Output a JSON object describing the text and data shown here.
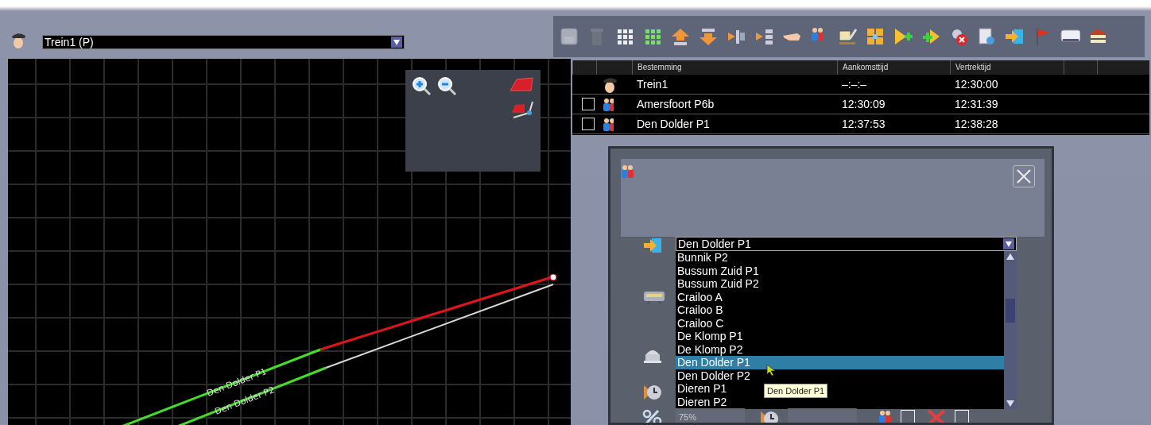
{
  "train_select": {
    "value": "Trein1 (P)"
  },
  "map": {
    "track_labels": [
      "Den Dolder P1",
      "Den Dolder P2"
    ]
  },
  "toolbar": [
    {
      "kind": "save",
      "disabled": true
    },
    {
      "kind": "trash",
      "disabled": true
    },
    {
      "kind": "small-grid",
      "disabled": false
    },
    {
      "kind": "grid",
      "disabled": false
    },
    {
      "kind": "move-up",
      "disabled": false
    },
    {
      "kind": "move-down",
      "disabled": false
    },
    {
      "kind": "insert-right",
      "disabled": false
    },
    {
      "kind": "insert-left",
      "disabled": false
    },
    {
      "kind": "hand",
      "disabled": false
    },
    {
      "kind": "people",
      "disabled": false
    },
    {
      "kind": "sign",
      "disabled": false
    },
    {
      "kind": "expand",
      "disabled": false
    },
    {
      "kind": "add-play",
      "disabled": false
    },
    {
      "kind": "add-arrow",
      "disabled": false
    },
    {
      "kind": "remove",
      "disabled": false
    },
    {
      "kind": "settings",
      "disabled": false
    },
    {
      "kind": "enter",
      "disabled": false
    },
    {
      "kind": "flag",
      "disabled": false
    },
    {
      "kind": "platform",
      "disabled": false
    },
    {
      "kind": "station",
      "disabled": false
    }
  ],
  "table": {
    "columns": [
      "Bestemming",
      "Aankomsttijd",
      "Vertrektijd"
    ],
    "rows": [
      {
        "kind": "train",
        "cells": [
          "Trein1",
          "–:–:–",
          "12:30:00"
        ]
      },
      {
        "kind": "stop",
        "checked": false,
        "cells": [
          "Amersfoort P6b",
          "12:30:09",
          "12:31:39"
        ]
      },
      {
        "kind": "stop",
        "checked": false,
        "cells": [
          "Den Dolder P1",
          "12:37:53",
          "12:38:28"
        ]
      }
    ]
  },
  "dialog": {
    "destination": {
      "value": "Den Dolder P1",
      "options": [
        {
          "label": "Bunnik P2",
          "selected": false
        },
        {
          "label": "Bussum Zuid P1",
          "selected": false
        },
        {
          "label": "Bussum Zuid P2",
          "selected": false
        },
        {
          "label": "Crailoo A",
          "selected": false
        },
        {
          "label": "Crailoo B",
          "selected": false
        },
        {
          "label": "Crailoo C",
          "selected": false
        },
        {
          "label": "De Klomp P1",
          "selected": false
        },
        {
          "label": "De Klomp P2",
          "selected": false
        },
        {
          "label": "Den Dolder P1",
          "selected": true
        },
        {
          "label": "Den Dolder P2",
          "selected": false
        },
        {
          "label": "Dieren P1",
          "selected": false
        },
        {
          "label": "Dieren P2",
          "selected": false
        }
      ]
    },
    "tooltip": "Den Dolder P1",
    "percent": "75%",
    "checkboxes": [
      {
        "checked": false
      },
      {
        "checked": false
      }
    ]
  }
}
